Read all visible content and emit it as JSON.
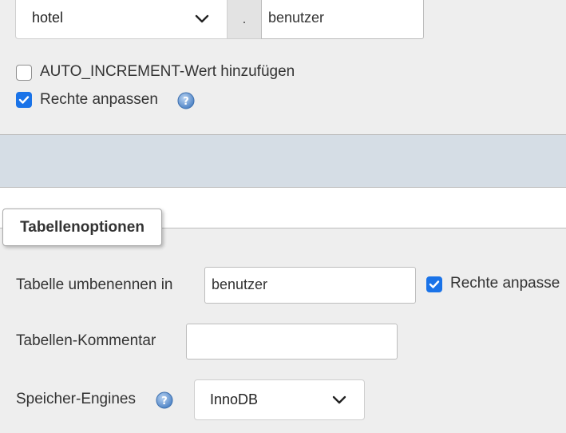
{
  "copy_table": {
    "database_select": {
      "value": "hotel",
      "icon": "chevron-down-icon"
    },
    "separator": ".",
    "table_name_input": {
      "value": "benutzer"
    },
    "options": [
      {
        "label": "AUTO_INCREMENT-Wert hinzufügen",
        "checked": false
      },
      {
        "label": "Rechte anpassen",
        "checked": true,
        "help_icon": "help-icon"
      }
    ]
  },
  "table_options": {
    "legend": "Tabellenoptionen",
    "rename": {
      "label": "Tabelle umbenennen in",
      "value": "benutzer",
      "adjust_privileges_label": "Rechte anpasse",
      "adjust_privileges_checked": true
    },
    "comment": {
      "label": "Tabellen-Kommentar",
      "value": ""
    },
    "storage_engine": {
      "label": "Speicher-Engines",
      "help_icon": "help-icon",
      "value": "InnoDB",
      "icon": "chevron-down-icon"
    }
  },
  "colors": {
    "background": "#eeeeee",
    "section_band": "#d5dde5",
    "checkbox_accent": "#1a73e8",
    "help_icon": "#5a8fd0"
  }
}
